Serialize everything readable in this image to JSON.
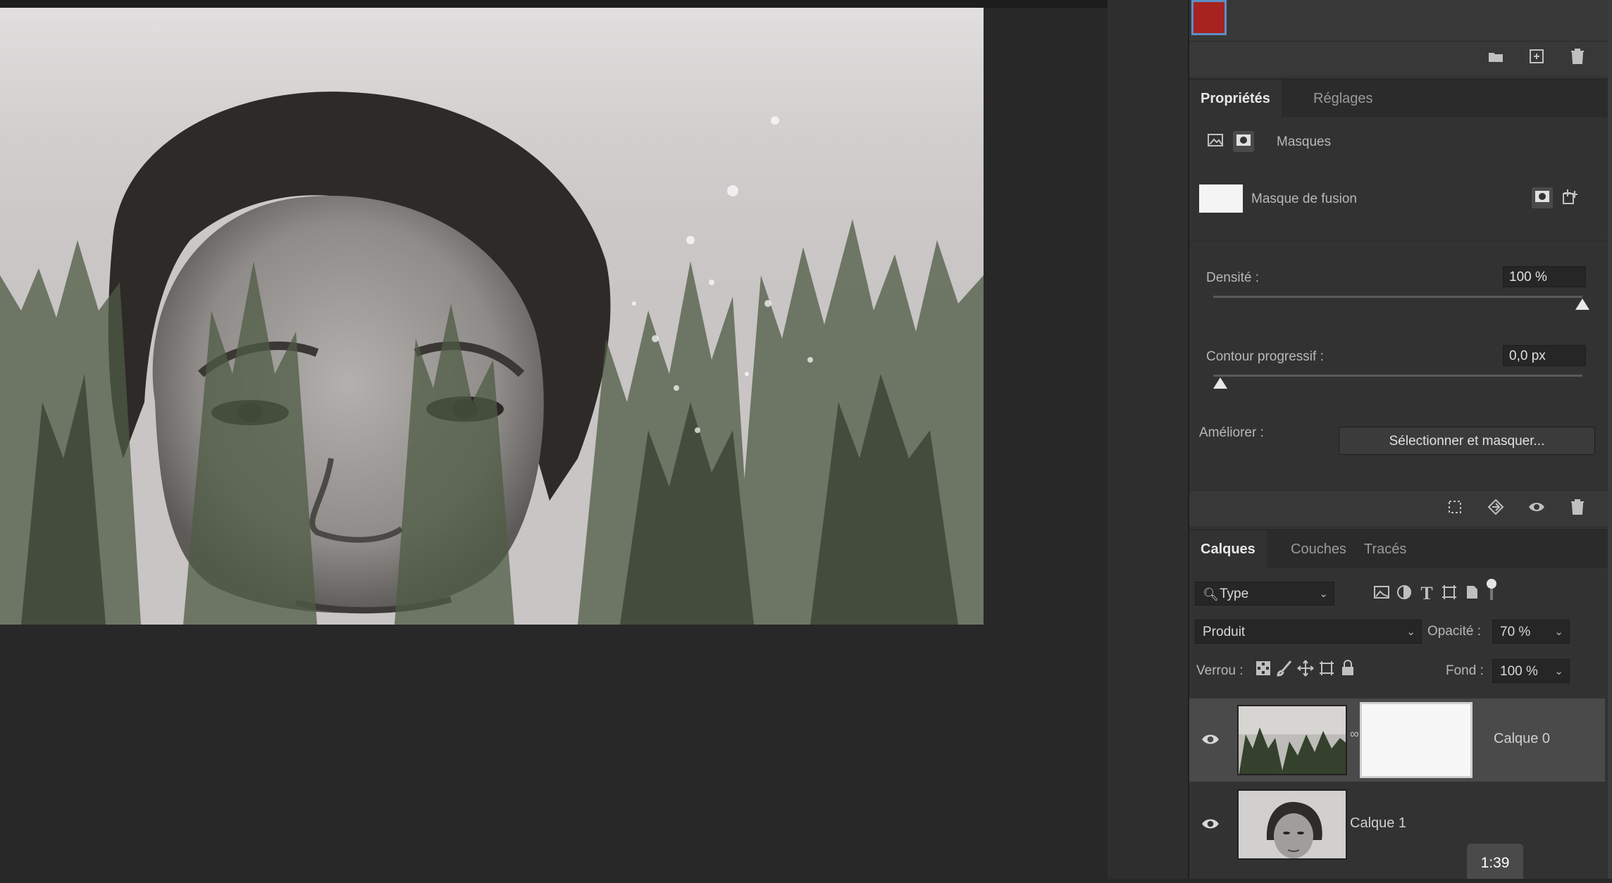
{
  "colors": {
    "foreground_swatch": "#a72320",
    "panel_bg": "#323232",
    "workspace_bg": "#282828"
  },
  "swatches_actions": {
    "icons": [
      "folder-icon",
      "new-swatch-icon",
      "trash-icon"
    ]
  },
  "properties": {
    "tabs": [
      {
        "label": "Propriétés",
        "active": true
      },
      {
        "label": "Réglages",
        "active": false
      }
    ],
    "mode_label": "Masques",
    "mask_name": "Masque de fusion",
    "density": {
      "label": "Densité :",
      "value": "100 %",
      "slider_fraction": 1.0
    },
    "feather": {
      "label": "Contour progressif :",
      "value": "0,0 px",
      "slider_fraction": 0.0
    },
    "refine": {
      "label": "Améliorer :",
      "button": "Sélectionner et masquer..."
    },
    "footer_icons": [
      "load-selection-icon",
      "apply-mask-icon",
      "visibility-icon",
      "trash-icon"
    ]
  },
  "layers": {
    "tabs": [
      {
        "label": "Calques",
        "active": true
      },
      {
        "label": "Couches",
        "active": false
      },
      {
        "label": "Tracés",
        "active": false
      }
    ],
    "filter": {
      "value": "Type"
    },
    "blend_mode": "Produit",
    "opacity": {
      "label": "Opacité :",
      "value": "70 %"
    },
    "lock_label": "Verrou :",
    "fill": {
      "label": "Fond :",
      "value": "100 %"
    },
    "items": [
      {
        "name": "Calque 0",
        "visible": true,
        "selected": true,
        "has_mask": true
      },
      {
        "name": "Calque 1",
        "visible": true,
        "selected": false,
        "has_mask": false
      }
    ]
  },
  "video": {
    "timestamp": "1:39"
  }
}
